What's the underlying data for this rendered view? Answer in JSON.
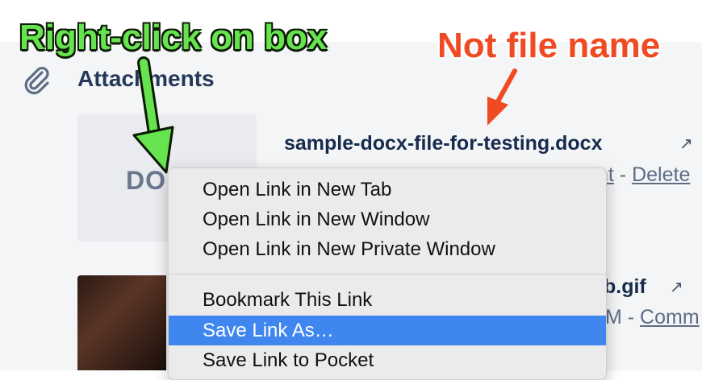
{
  "section": {
    "title": "Attachments"
  },
  "attachment1": {
    "thumb_label": "DO",
    "file_name": "sample-docx-file-for-testing.docx",
    "meta_fragment": "nt",
    "meta_sep": " - ",
    "meta_action": "Delete"
  },
  "attachment2": {
    "file_name_fragment": "b.gif",
    "meta_fragment": "M",
    "meta_sep": " - ",
    "meta_action": "Comm"
  },
  "context_menu": {
    "items": [
      "Open Link in New Tab",
      "Open Link in New Window",
      "Open Link in New Private Window",
      "Bookmark This Link",
      "Save Link As…",
      "Save Link to Pocket"
    ],
    "highlighted": "Save Link As…"
  },
  "annotations": {
    "green_text": "Right-click on box",
    "red_text": "Not file name"
  },
  "colors": {
    "highlight": "#3f86ee",
    "annotation_green": "#66e34f",
    "annotation_red": "#f04a22"
  },
  "icons": {
    "external": "↗"
  }
}
